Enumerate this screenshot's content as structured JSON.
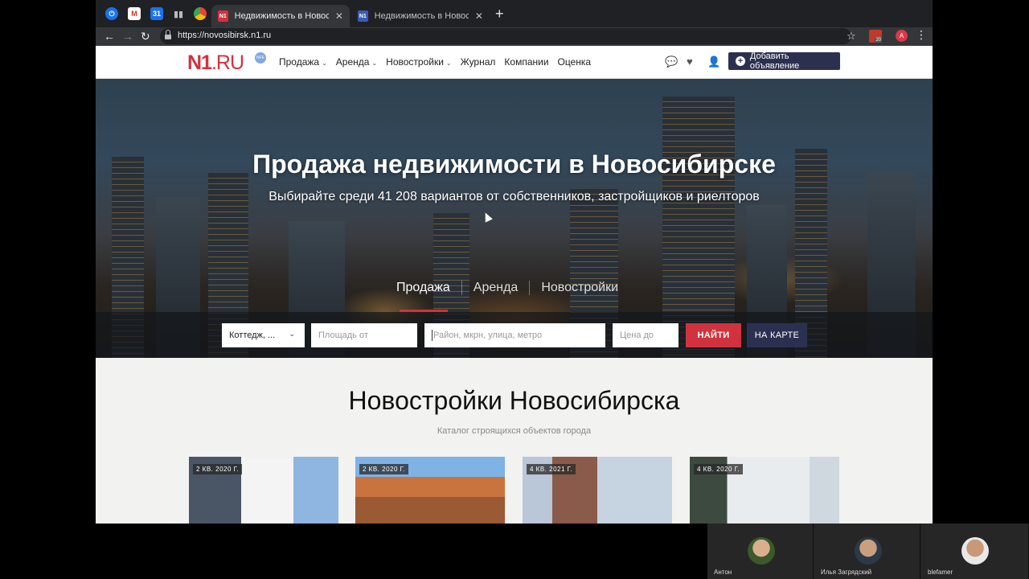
{
  "browser": {
    "tabs": [
      {
        "title": "Недвижимость в Новосибирс",
        "active": true,
        "favicon": "N1"
      },
      {
        "title": "Недвижимость в Новосибирс",
        "active": false,
        "favicon": "N1"
      }
    ],
    "pinned_icons": [
      "power-icon",
      "gmail-icon",
      "calendar-icon",
      "analytics-icon",
      "chrome-icon"
    ],
    "url": "https://novosibirsk.n1.ru",
    "extension_badge": "20",
    "profile_initial": "А"
  },
  "site": {
    "logo": {
      "brand": "N1",
      "suffix": ".RU"
    },
    "nav": [
      {
        "label": "Продажа",
        "dropdown": true
      },
      {
        "label": "Аренда",
        "dropdown": true
      },
      {
        "label": "Новостройки",
        "dropdown": true
      },
      {
        "label": "Журнал",
        "dropdown": false
      },
      {
        "label": "Компании",
        "dropdown": false
      },
      {
        "label": "Оценка",
        "dropdown": false
      }
    ],
    "add_button": "Добавить объявление",
    "accent": "#d0333d",
    "navy": "#2c3050"
  },
  "hero": {
    "title": "Продажа недвижимости в Новосибирске",
    "subtitle": "Выбирайте среди 41 208 вариантов от собственников, застройщиков и риелторов",
    "tabs": [
      "Продажа",
      "Аренда",
      "Новостройки"
    ],
    "active_tab": "Продажа"
  },
  "search": {
    "type_select": "Коттедж, ...",
    "area_placeholder": "Площадь от",
    "location_placeholder": "Район, мкрн, улица, метро",
    "price_placeholder": "Цена до",
    "find_button": "НАЙТИ",
    "map_button": "НА КАРТЕ"
  },
  "new_buildings": {
    "title": "Новостройки Новосибирска",
    "subtitle": "Каталог строящихся объектов города",
    "cards": [
      {
        "badge": "2 КВ. 2020 Г."
      },
      {
        "badge": "2 КВ. 2020 Г."
      },
      {
        "badge": "4 КВ. 2021 Г."
      },
      {
        "badge": "4 КВ. 2020 Г."
      }
    ]
  },
  "call": {
    "participants": [
      {
        "name": "Антон"
      },
      {
        "name": "Илья Загрядский"
      },
      {
        "name": "blefamer"
      }
    ]
  }
}
